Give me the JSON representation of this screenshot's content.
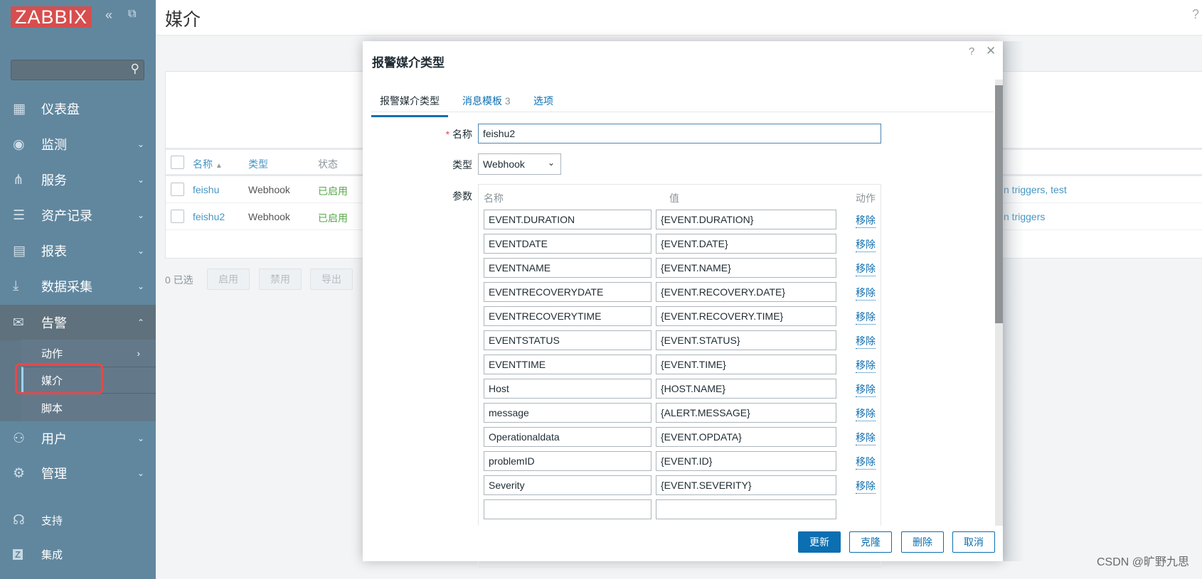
{
  "sidebar": {
    "logo": "ZABBIX",
    "nav": [
      {
        "label": "仪表盘",
        "icon": "dashboard-icon",
        "glyph": "▦",
        "chev": false
      },
      {
        "label": "监测",
        "icon": "eye-icon",
        "glyph": "◉",
        "chev": true
      },
      {
        "label": "服务",
        "icon": "hierarchy-icon",
        "glyph": "⋔",
        "chev": true
      },
      {
        "label": "资产记录",
        "icon": "list-icon",
        "glyph": "☰",
        "chev": true
      },
      {
        "label": "报表",
        "icon": "report-icon",
        "glyph": "▤",
        "chev": true
      },
      {
        "label": "数据采集",
        "icon": "download-icon",
        "glyph": "⤓",
        "chev": true
      },
      {
        "label": "告警",
        "icon": "envelope-icon",
        "glyph": "✉",
        "chev": true
      },
      {
        "label": "用户",
        "icon": "users-icon",
        "glyph": "⚇",
        "chev": true
      },
      {
        "label": "管理",
        "icon": "gear-icon",
        "glyph": "⚙",
        "chev": true
      }
    ],
    "sub": [
      "动作",
      "媒介",
      "脚本"
    ],
    "bottom": [
      {
        "label": "支持",
        "icon": "headset-icon",
        "glyph": "☊"
      },
      {
        "label": "集成",
        "icon": "zabbix-integration-icon",
        "glyph": "Z"
      }
    ]
  },
  "header": {
    "title": "媒介"
  },
  "table": {
    "headers": [
      "名称",
      "类型",
      "状态"
    ],
    "rows": [
      {
        "name": "feishu",
        "type": "Webhook",
        "status": "已启用",
        "used": "n triggers, test"
      },
      {
        "name": "feishu2",
        "type": "Webhook",
        "status": "已启用",
        "used": "n triggers"
      }
    ],
    "selected": "0 已选",
    "buttons": [
      "启用",
      "禁用",
      "导出"
    ]
  },
  "dialog": {
    "title": "报警媒介类型",
    "help": "?",
    "close": "✕",
    "tabs": [
      {
        "label": "报警媒介类型"
      },
      {
        "label": "消息模板",
        "count": "3"
      },
      {
        "label": "选项"
      }
    ],
    "name_label": "名称",
    "name_value": "feishu2",
    "type_label": "类型",
    "type_value": "Webhook",
    "params_label": "参数",
    "params_headers": [
      "名称",
      "值",
      "动作"
    ],
    "remove_label": "移除",
    "params": [
      [
        "EVENT.DURATION",
        "{EVENT.DURATION}"
      ],
      [
        "EVENTDATE",
        "{EVENT.DATE}"
      ],
      [
        "EVENTNAME",
        "{EVENT.NAME}"
      ],
      [
        "EVENTRECOVERYDATE",
        "{EVENT.RECOVERY.DATE}"
      ],
      [
        "EVENTRECOVERYTIME",
        "{EVENT.RECOVERY.TIME}"
      ],
      [
        "EVENTSTATUS",
        "{EVENT.STATUS}"
      ],
      [
        "EVENTTIME",
        "{EVENT.TIME}"
      ],
      [
        "Host",
        "{HOST.NAME}"
      ],
      [
        "message",
        "{ALERT.MESSAGE}"
      ],
      [
        "Operationaldata",
        "{EVENT.OPDATA}"
      ],
      [
        "problemID",
        "{EVENT.ID}"
      ],
      [
        "Severity",
        "{EVENT.SEVERITY}"
      ],
      [
        "",
        ""
      ]
    ],
    "buttons": {
      "update": "更新",
      "clone": "克隆",
      "delete": "删除",
      "cancel": "取消"
    }
  },
  "watermark": "CSDN @旷野九思",
  "colors": {
    "sidebar": "#61879f",
    "accent": "#0b6fb1",
    "logo": "#d64e4e",
    "enabled": "#59a84b"
  }
}
